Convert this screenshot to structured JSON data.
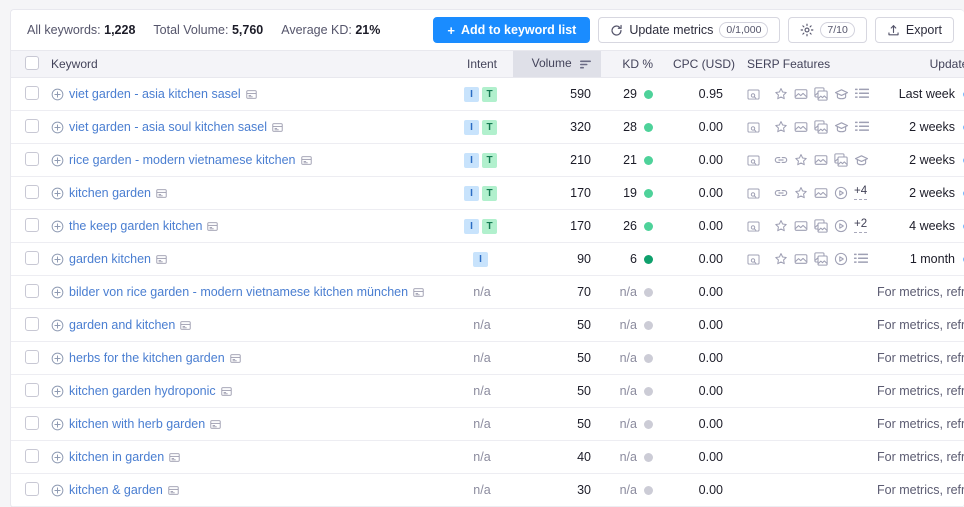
{
  "summary": {
    "all_keywords_label": "All keywords:",
    "all_keywords_value": "1,228",
    "total_volume_label": "Total Volume:",
    "total_volume_value": "5,760",
    "average_kd_label": "Average KD:",
    "average_kd_value": "21%"
  },
  "toolbar": {
    "add_to_list_label": "Add to keyword list",
    "add_plus": "+",
    "update_metrics_label": "Update metrics",
    "update_metrics_counter": "0/1,000",
    "settings_counter": "7/10",
    "export_label": "Export"
  },
  "table": {
    "headers": {
      "keyword": "Keyword",
      "intent": "Intent",
      "volume": "Volume",
      "kd": "KD %",
      "cpc": "CPC (USD)",
      "serp_features": "SERP Features",
      "updated": "Updated"
    },
    "sorted_column": "volume",
    "colors": {
      "kd_green": "#4ed29a",
      "kd_dark_green": "#0fa06c",
      "kd_gray": "#ccccd6",
      "link": "#4a7ed1",
      "accent": "#1a8cff",
      "intent_i_bg": "#c8e3fc",
      "intent_t_bg": "#b1f0cd"
    },
    "rows": [
      {
        "keyword": "viet garden - asia kitchen sasel",
        "intent": [
          "I",
          "T"
        ],
        "volume": "590",
        "kd": "29",
        "kd_color": "#4ed29a",
        "cpc": "0.95",
        "serp": [
          "search-preview",
          "divider",
          "star",
          "image",
          "images",
          "knowledge",
          "list"
        ],
        "serp_more": "",
        "updated": "Last week"
      },
      {
        "keyword": "viet garden - asia soul kitchen sasel",
        "intent": [
          "I",
          "T"
        ],
        "volume": "320",
        "kd": "28",
        "kd_color": "#4ed29a",
        "cpc": "0.00",
        "serp": [
          "search-preview",
          "divider",
          "star",
          "image",
          "images",
          "knowledge",
          "list"
        ],
        "serp_more": "",
        "updated": "2 weeks"
      },
      {
        "keyword": "rice garden - modern vietnamese kitchen",
        "intent": [
          "I",
          "T"
        ],
        "volume": "210",
        "kd": "21",
        "kd_color": "#4ed29a",
        "cpc": "0.00",
        "serp": [
          "search-preview",
          "divider",
          "link",
          "star",
          "image",
          "images",
          "knowledge"
        ],
        "serp_more": "",
        "updated": "2 weeks"
      },
      {
        "keyword": "kitchen garden",
        "intent": [
          "I",
          "T"
        ],
        "volume": "170",
        "kd": "19",
        "kd_color": "#4ed29a",
        "cpc": "0.00",
        "serp": [
          "search-preview",
          "divider",
          "link",
          "star",
          "image",
          "video"
        ],
        "serp_more": "+4",
        "updated": "2 weeks"
      },
      {
        "keyword": "the keep garden kitchen",
        "intent": [
          "I",
          "T"
        ],
        "volume": "170",
        "kd": "26",
        "kd_color": "#4ed29a",
        "cpc": "0.00",
        "serp": [
          "search-preview",
          "divider",
          "star",
          "image",
          "images",
          "video"
        ],
        "serp_more": "+2",
        "updated": "4 weeks"
      },
      {
        "keyword": "garden kitchen",
        "intent": [
          "I"
        ],
        "volume": "90",
        "kd": "6",
        "kd_color": "#0fa06c",
        "cpc": "0.00",
        "serp": [
          "search-preview",
          "divider",
          "star",
          "image",
          "images",
          "video",
          "list"
        ],
        "serp_more": "",
        "updated": "1 month"
      },
      {
        "keyword": "bilder von rice garden - modern vietnamese kitchen münchen",
        "intent": [],
        "intent_na": "n/a",
        "volume": "70",
        "kd": "n/a",
        "kd_color": "#ccccd6",
        "cpc": "0.00",
        "serp": [],
        "serp_more": "",
        "updated": "For metrics, refresh"
      },
      {
        "keyword": "garden and kitchen",
        "intent": [],
        "intent_na": "n/a",
        "volume": "50",
        "kd": "n/a",
        "kd_color": "#ccccd6",
        "cpc": "0.00",
        "serp": [],
        "serp_more": "",
        "updated": "For metrics, refresh"
      },
      {
        "keyword": "herbs for the kitchen garden",
        "intent": [],
        "intent_na": "n/a",
        "volume": "50",
        "kd": "n/a",
        "kd_color": "#ccccd6",
        "cpc": "0.00",
        "serp": [],
        "serp_more": "",
        "updated": "For metrics, refresh"
      },
      {
        "keyword": "kitchen garden hydroponic",
        "intent": [],
        "intent_na": "n/a",
        "volume": "50",
        "kd": "n/a",
        "kd_color": "#ccccd6",
        "cpc": "0.00",
        "serp": [],
        "serp_more": "",
        "updated": "For metrics, refresh"
      },
      {
        "keyword": "kitchen with herb garden",
        "intent": [],
        "intent_na": "n/a",
        "volume": "50",
        "kd": "n/a",
        "kd_color": "#ccccd6",
        "cpc": "0.00",
        "serp": [],
        "serp_more": "",
        "updated": "For metrics, refresh"
      },
      {
        "keyword": "kitchen in garden",
        "intent": [],
        "intent_na": "n/a",
        "volume": "40",
        "kd": "n/a",
        "kd_color": "#ccccd6",
        "cpc": "0.00",
        "serp": [],
        "serp_more": "",
        "updated": "For metrics, refresh"
      },
      {
        "keyword": "kitchen & garden",
        "intent": [],
        "intent_na": "n/a",
        "volume": "30",
        "kd": "n/a",
        "kd_color": "#ccccd6",
        "cpc": "0.00",
        "serp": [],
        "serp_more": "",
        "updated": "For metrics, refresh"
      }
    ]
  }
}
